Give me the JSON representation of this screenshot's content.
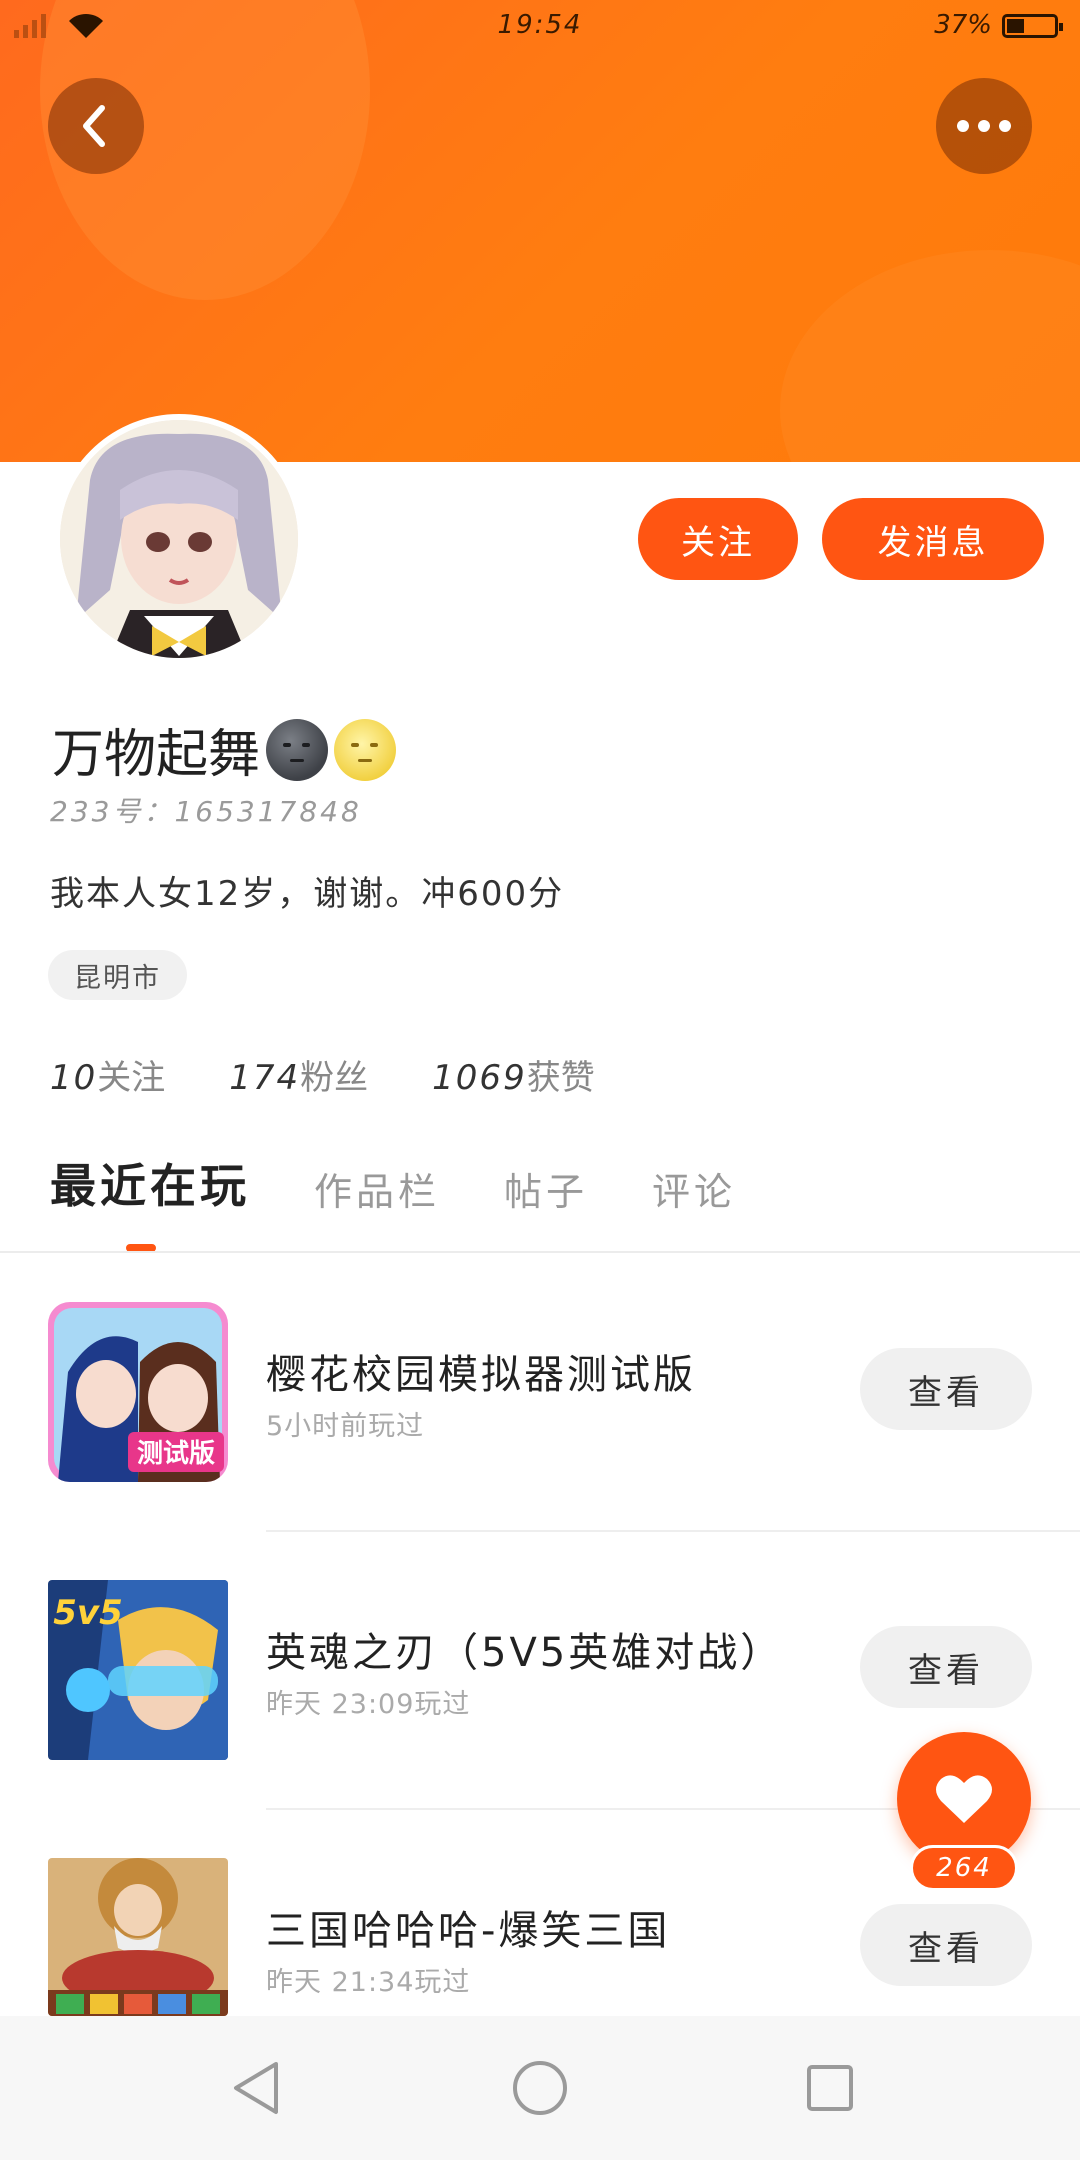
{
  "status_bar": {
    "time": "19:54",
    "battery_pct": "37%",
    "battery_level": 0.37
  },
  "header": {
    "back_icon": "chevron-left-icon",
    "more_icon": "more-dots-icon"
  },
  "profile": {
    "follow_label": "关注",
    "message_label": "发消息",
    "username": "万物起舞",
    "username_emojis": [
      "new-moon-face",
      "full-moon-face"
    ],
    "uid": "233号：165317848",
    "bio": "我本人女12岁，谢谢。冲600分",
    "location": "昆明市",
    "stats": [
      {
        "num": "10",
        "label": "关注"
      },
      {
        "num": "174",
        "label": "粉丝"
      },
      {
        "num": "1069",
        "label": "获赞"
      }
    ]
  },
  "tabs": [
    "最近在玩",
    "作品栏",
    "帖子",
    "评论"
  ],
  "active_tab": 0,
  "games": [
    {
      "title": "樱花校园模拟器测试版",
      "time": "5小时前玩过",
      "button": "查看",
      "icon_text": "测试版"
    },
    {
      "title": "英魂之刃（5V5英雄对战）",
      "time": "昨天 23:09玩过",
      "button": "查看",
      "icon_text": "5v5"
    },
    {
      "title": "三国哈哈哈-爆笑三国",
      "time": "昨天 21:34玩过",
      "button": "查看",
      "icon_text": ""
    }
  ],
  "like_fab": {
    "count": "264"
  },
  "colors": {
    "accent": "#ff5512",
    "banner": "#ff7a10"
  }
}
